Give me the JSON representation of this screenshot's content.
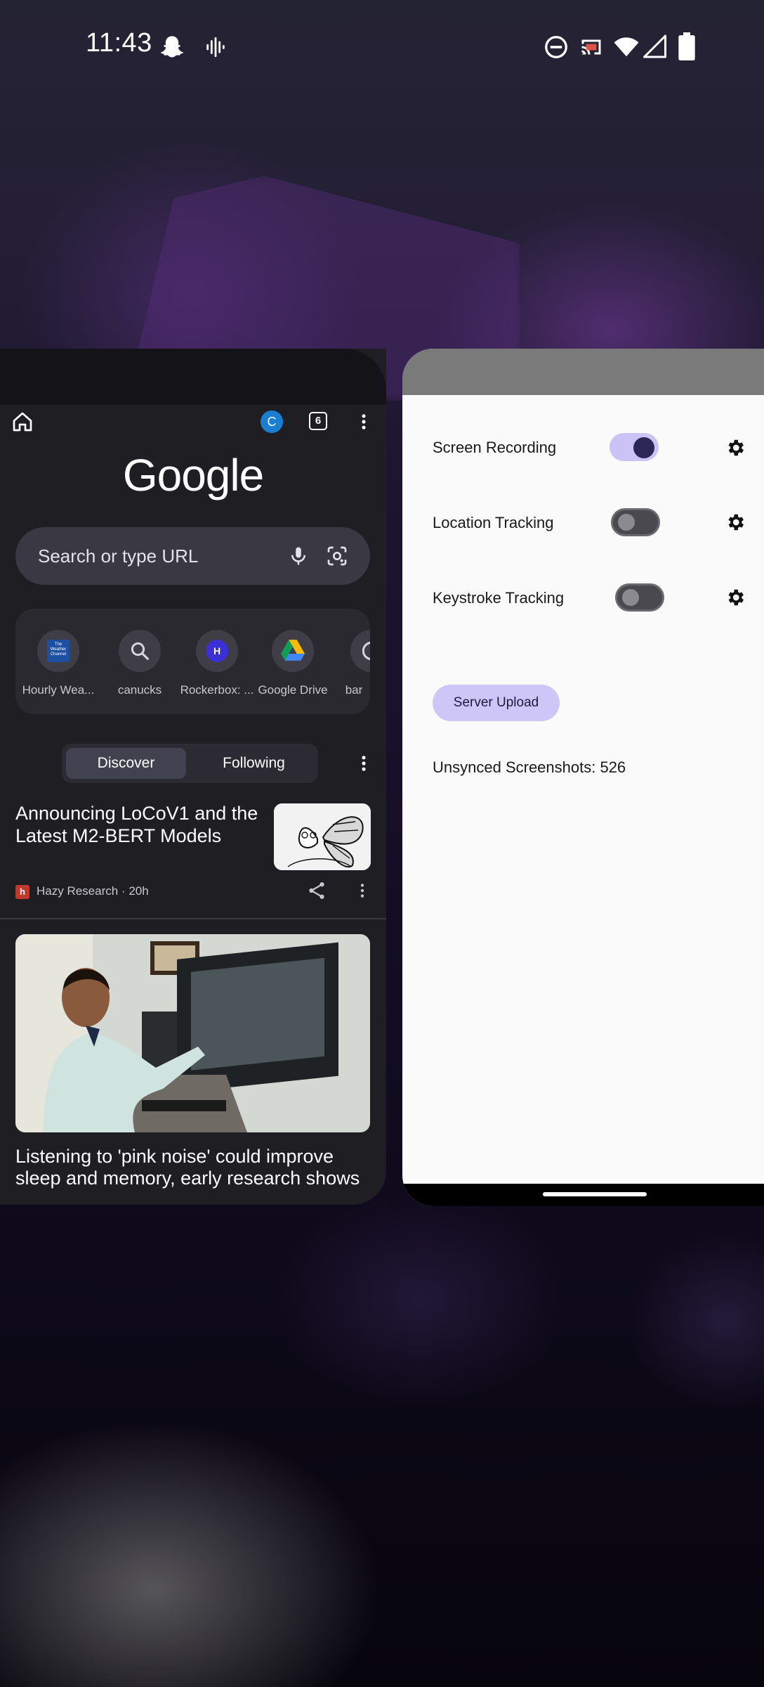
{
  "status_bar": {
    "time": "11:43",
    "left_icons": [
      "snapchat-icon",
      "voice-recorder-icon"
    ],
    "right_icons": [
      "do-not-disturb-icon",
      "cast-icon",
      "wifi-icon",
      "signal-icon",
      "battery-icon"
    ]
  },
  "chrome": {
    "toolbar": {
      "account_initial": "C",
      "tab_count": "6"
    },
    "logo": "Google",
    "search": {
      "placeholder": "Search or type URL"
    },
    "shortcuts": [
      {
        "label": "Hourly Wea...",
        "icon": "weather-channel-icon",
        "logo_text": "The Weather Channel"
      },
      {
        "label": "canucks",
        "icon": "search-icon"
      },
      {
        "label": "Rockerbox: ...",
        "icon": "rockerbox-icon",
        "logo_text": "H"
      },
      {
        "label": "Google Drive",
        "icon": "google-drive-icon"
      },
      {
        "label": "bar",
        "icon": "chrome-icon"
      }
    ],
    "feed_tabs": {
      "active": "Discover",
      "inactive": "Following"
    },
    "articles": [
      {
        "title": "Announcing LoCoV1 and the Latest M2-BERT Models",
        "source": "Hazy Research · 20h",
        "icon": "butterfly-thumbnail"
      },
      {
        "title": "Listening to 'pink noise' could improve sleep and memory, early research shows",
        "icon": "man-at-computer-photo"
      }
    ]
  },
  "tracker_app": {
    "rows": [
      {
        "label": "Screen Recording",
        "enabled": true
      },
      {
        "label": "Location Tracking",
        "enabled": false
      },
      {
        "label": "Keystroke Tracking",
        "enabled": false
      }
    ],
    "upload_button": "Server Upload",
    "unsynced": "Unsynced Screenshots: 526"
  },
  "colors": {
    "accent": "#cbc3f5",
    "chrome_surface": "#1f1f23",
    "app_surface": "#fafafa"
  }
}
